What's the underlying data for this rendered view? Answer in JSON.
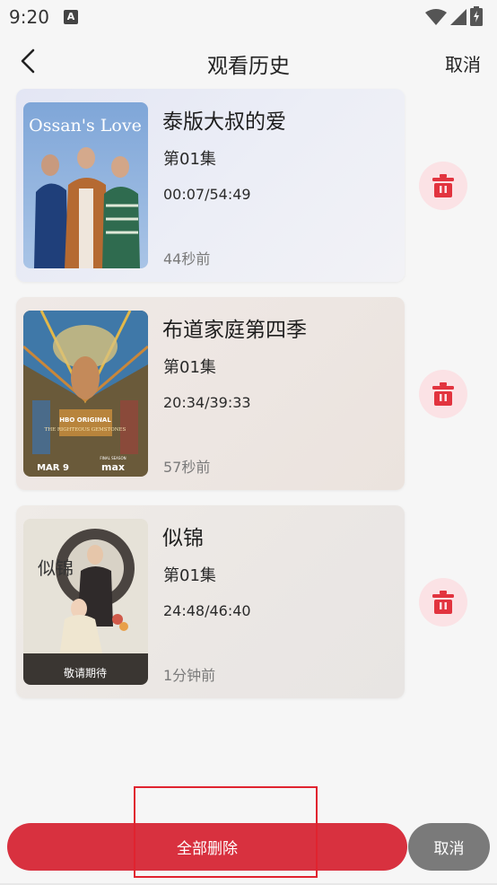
{
  "status_bar": {
    "time": "9:20",
    "notification_icon": "A"
  },
  "header": {
    "title": "观看历史",
    "cancel_label": "取消",
    "back_icon": "chevron-left-icon"
  },
  "history": [
    {
      "title": "泰版大叔的爱",
      "episode": "第01集",
      "progress": "00:07/54:49",
      "time_ago": "44秒前",
      "poster_text": "Ossan's Love"
    },
    {
      "title": "布道家庭第四季",
      "episode": "第01集",
      "progress": "20:34/39:33",
      "time_ago": "57秒前",
      "poster_text": "THE RIGHTEOUS GEMSTONES",
      "poster_badge": "HBO ORIGINAL",
      "poster_date": "MAR 9",
      "poster_brand": "max",
      "poster_note": "FINAL SEASON"
    },
    {
      "title": "似锦",
      "episode": "第01集",
      "progress": "24:48/46:40",
      "time_ago": "1分钟前",
      "poster_text": "敬请期待",
      "poster_calligraphy": "似锦"
    }
  ],
  "footer": {
    "delete_all_label": "全部删除",
    "cancel_label": "取消"
  },
  "colors": {
    "accent": "#d8313f",
    "delete_bg": "#fbe2e5",
    "cancel_bg": "#7a7a7a",
    "highlight": "#e0232f"
  }
}
